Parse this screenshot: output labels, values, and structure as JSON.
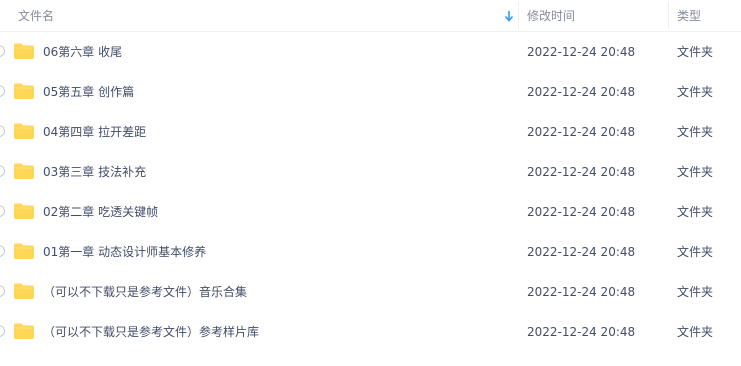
{
  "header": {
    "name_label": "文件名",
    "modified_label": "修改时间",
    "type_label": "类型",
    "sort_icon": "arrow-down-icon",
    "sort_color": "#2e9cff"
  },
  "folder_color": "#ffd656",
  "files": [
    {
      "name": "06第六章 收尾",
      "modified": "2022-12-24 20:48",
      "type": "文件夹"
    },
    {
      "name": "05第五章 创作篇",
      "modified": "2022-12-24 20:48",
      "type": "文件夹"
    },
    {
      "name": "04第四章 拉开差距",
      "modified": "2022-12-24 20:48",
      "type": "文件夹"
    },
    {
      "name": "03第三章 技法补充",
      "modified": "2022-12-24 20:48",
      "type": "文件夹"
    },
    {
      "name": "02第二章 吃透关键帧",
      "modified": "2022-12-24 20:48",
      "type": "文件夹"
    },
    {
      "name": "01第一章 动态设计师基本修养",
      "modified": "2022-12-24 20:48",
      "type": "文件夹"
    },
    {
      "name": "（可以不下载只是参考文件）音乐合集",
      "modified": "2022-12-24 20:48",
      "type": "文件夹"
    },
    {
      "name": "（可以不下载只是参考文件）参考样片库",
      "modified": "2022-12-24 20:48",
      "type": "文件夹"
    }
  ]
}
